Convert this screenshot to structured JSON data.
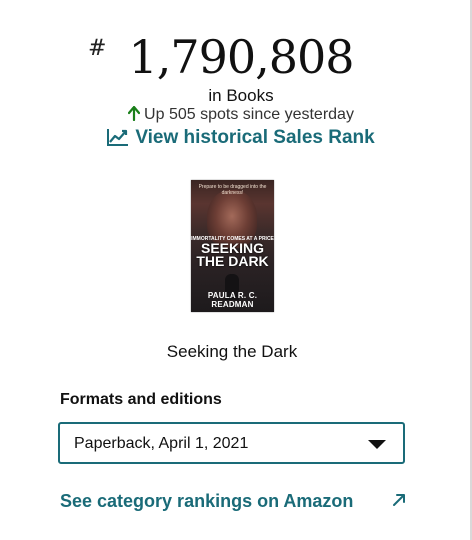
{
  "rank": {
    "hash_symbol": "#",
    "number": "1,790,808",
    "category": "in Books",
    "change_text": "Up 505 spots since yesterday",
    "change_icon": "up-arrow-icon",
    "change_color": "#1a7f1a",
    "history_link_label": "View historical Sales Rank",
    "history_icon": "trend-chart-icon"
  },
  "book": {
    "cover": {
      "tagline": "Prepare to be dragged into the darkness!",
      "subtitle": "IMMORTALITY COMES AT A PRICE",
      "title": "SEEKING THE DARK",
      "author": "PAULA R. C. READMAN"
    },
    "title": "Seeking the Dark"
  },
  "formats": {
    "heading": "Formats and editions",
    "selected": "Paperback, April 1, 2021",
    "dropdown_icon": "caret-down-icon"
  },
  "category_link": {
    "label": "See category rankings on Amazon",
    "icon": "external-link-icon"
  },
  "colors": {
    "link": "#1a6b78",
    "accent_border": "#1a6b78",
    "text": "#111111"
  }
}
